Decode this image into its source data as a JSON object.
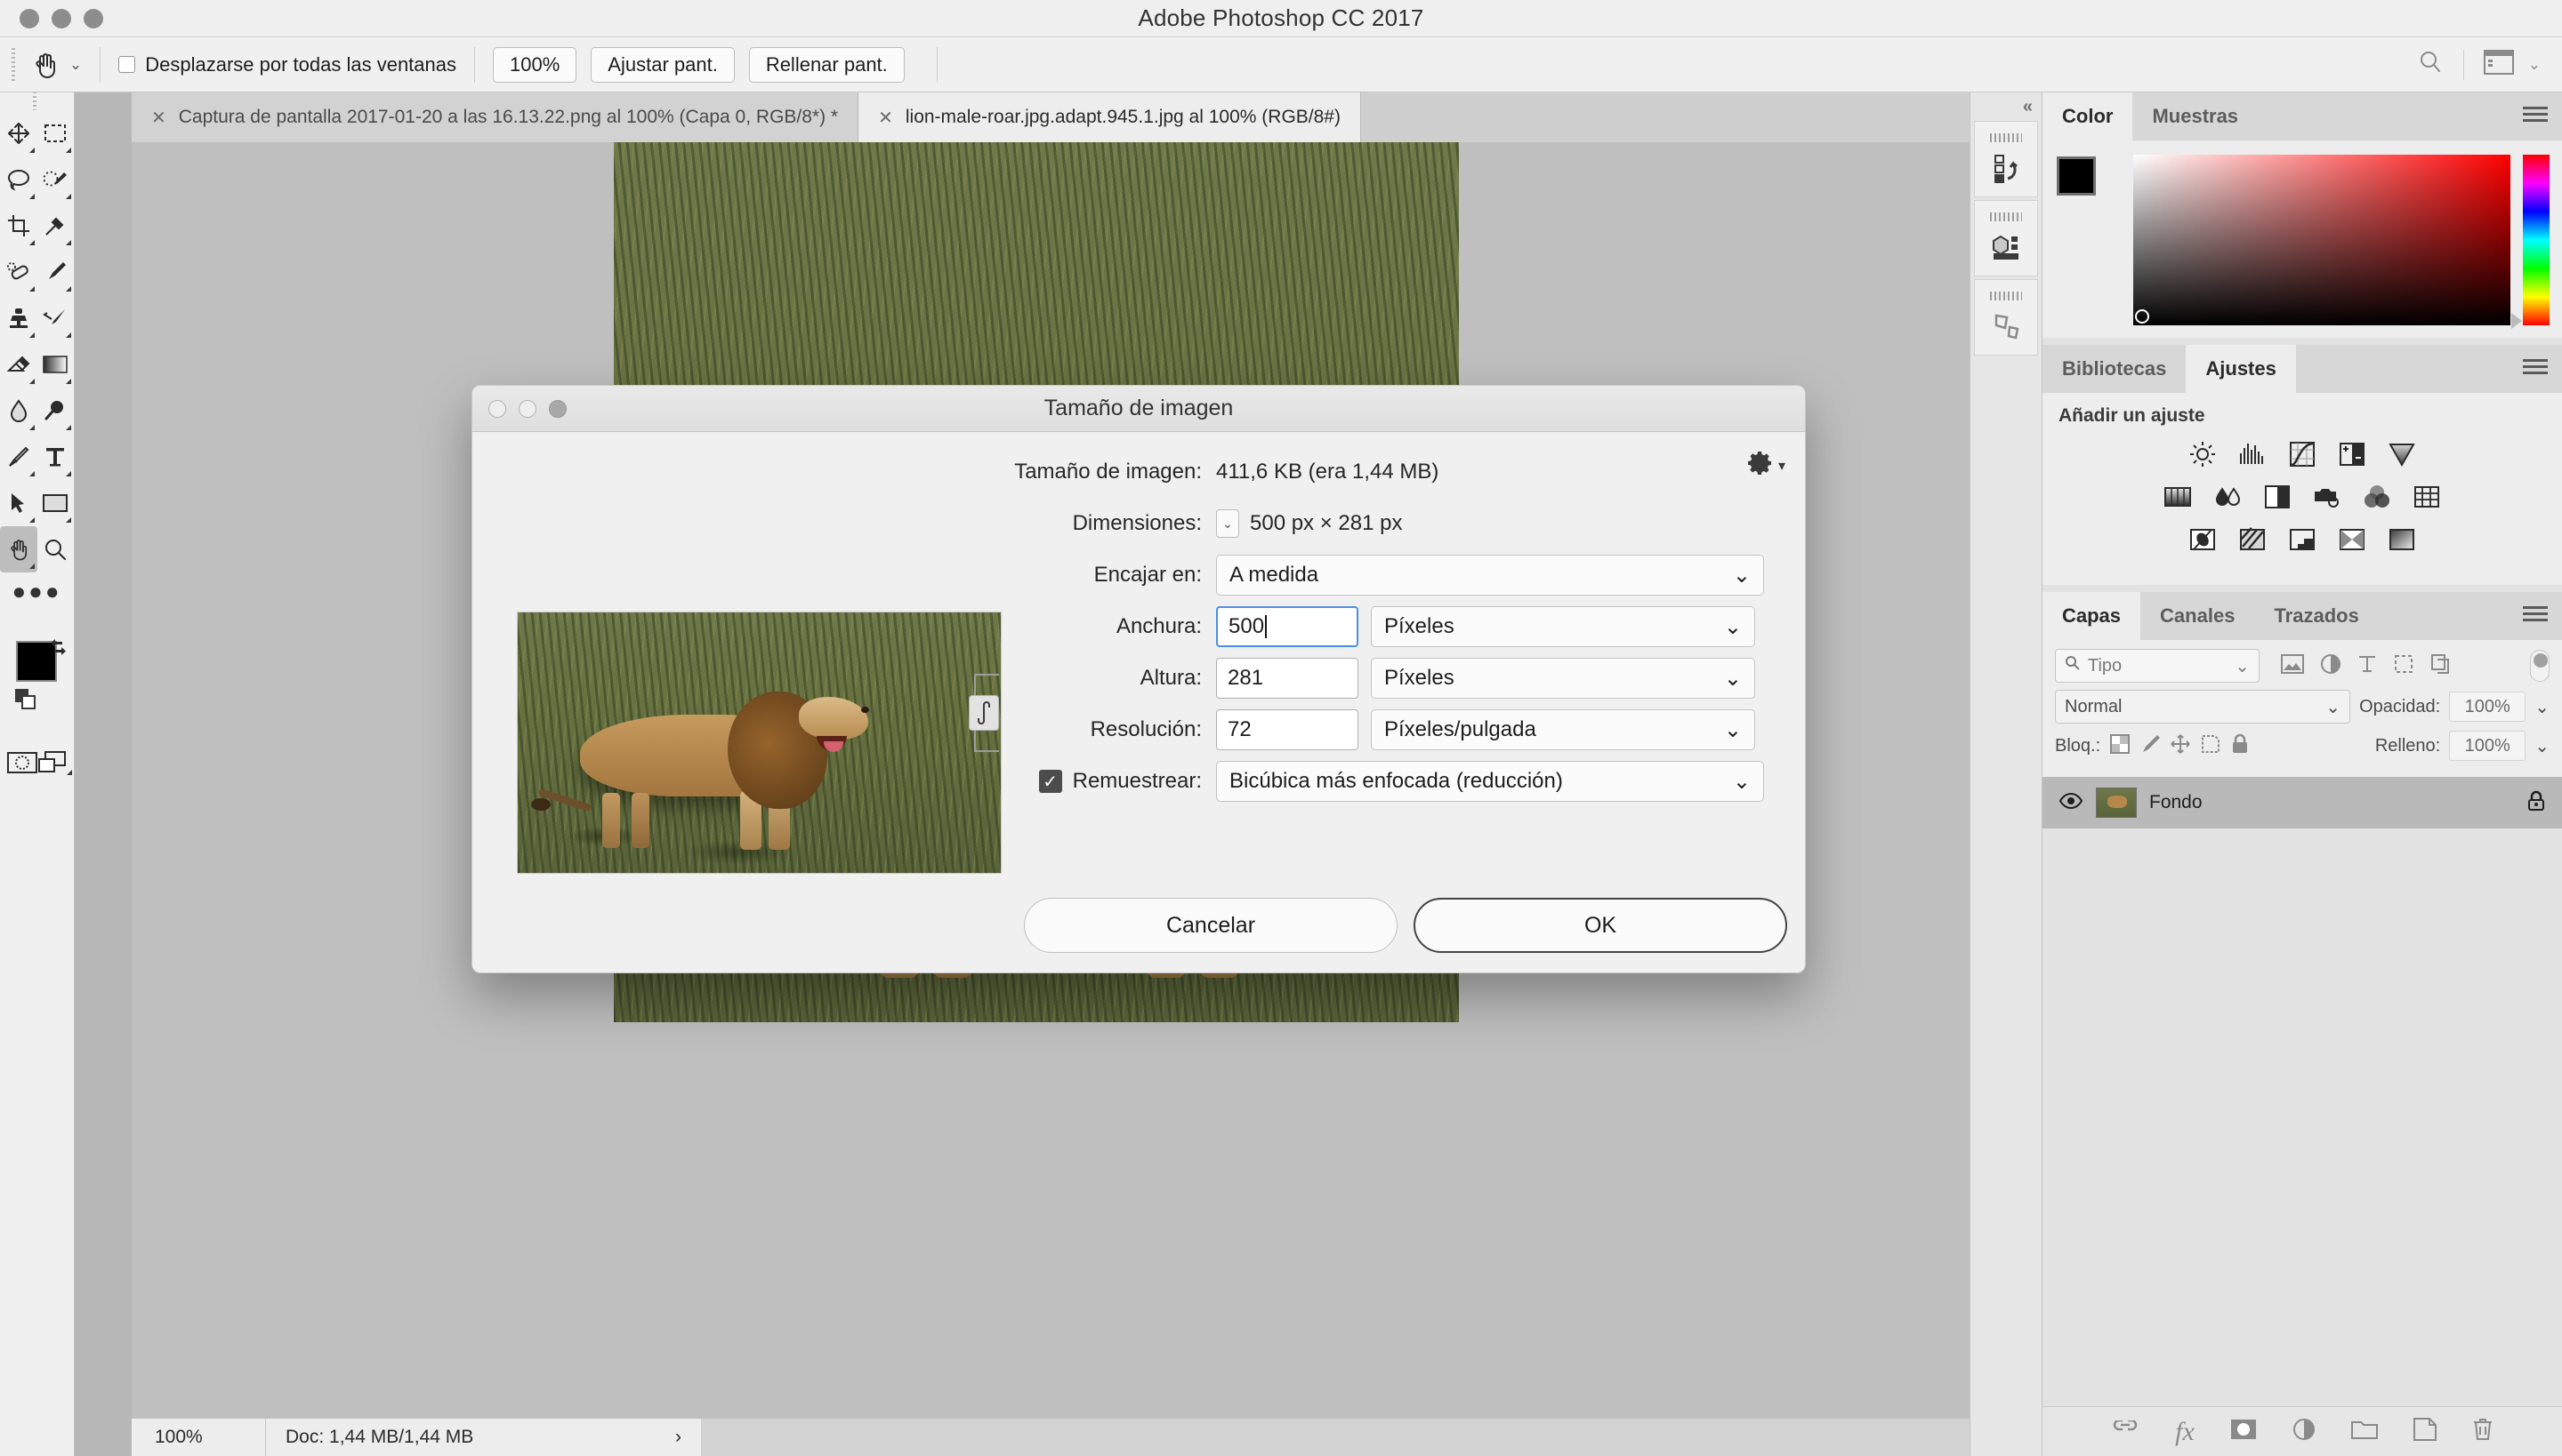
{
  "window": {
    "title": "Adobe Photoshop CC 2017"
  },
  "options_bar": {
    "tool_icon": "hand-tool-icon",
    "scroll_all_windows_label": "Desplazarse por todas las ventanas",
    "scroll_all_windows_checked": false,
    "buttons": [
      "100%",
      "Ajustar pant.",
      "Rellenar pant."
    ],
    "search_icon": "search-icon",
    "workspace_icon": "workspace-switcher-icon"
  },
  "tabs": [
    {
      "label": "Captura de pantalla 2017-01-20 a las 16.13.22.png al 100% (Capa 0, RGB/8*) *",
      "active": false,
      "close": "✕"
    },
    {
      "label": "lion-male-roar.jpg.adapt.945.1.jpg al 100% (RGB/8#)",
      "active": true,
      "close": "✕"
    }
  ],
  "toolbar": {
    "tools": [
      [
        "move-tool-icon",
        "rectangular-marquee-tool-icon"
      ],
      [
        "lasso-tool-icon",
        "quick-selection-tool-icon"
      ],
      [
        "crop-tool-icon",
        "eyedropper-tool-icon"
      ],
      [
        "spot-healing-brush-tool-icon",
        "brush-tool-icon"
      ],
      [
        "clone-stamp-tool-icon",
        "history-brush-tool-icon"
      ],
      [
        "eraser-tool-icon",
        "gradient-tool-icon"
      ],
      [
        "blur-tool-icon",
        "dodge-tool-icon"
      ],
      [
        "pen-tool-icon",
        "type-tool-icon"
      ],
      [
        "path-selection-tool-icon",
        "rectangle-tool-icon"
      ],
      [
        "hand-tool-icon",
        "zoom-tool-icon"
      ]
    ],
    "selected_tool": "hand-tool-icon",
    "more_tools_icon": "more-tools-icon",
    "foreground_color": "#000000",
    "background_color": "#ffffff",
    "swap_colors_icon": "swap-colors-icon",
    "default_colors_icon": "default-colors-icon",
    "quick_mask_icon": "quick-mask-mode-icon",
    "screen_mode_icon": "screen-mode-icon"
  },
  "status_bar": {
    "zoom": "100%",
    "doc_info": "Doc: 1,44 MB/1,44 MB",
    "expand_icon": "›"
  },
  "rail": {
    "collapse_icon": "«",
    "buttons": [
      "history-panel-icon",
      "3d-panel-icon",
      "properties-panel-icon"
    ]
  },
  "panels": {
    "color": {
      "tabs": [
        {
          "label": "Color",
          "active": true
        },
        {
          "label": "Muestras",
          "active": false
        }
      ],
      "menu_icon": "panel-menu-icon",
      "foreground_color": "#000000",
      "background_color": "#ffffff"
    },
    "adjustments": {
      "tabs": [
        {
          "label": "Bibliotecas",
          "active": false
        },
        {
          "label": "Ajustes",
          "active": true
        }
      ],
      "menu_icon": "panel-menu-icon",
      "heading": "Añadir un ajuste",
      "icons": [
        [
          "brightness-contrast-icon",
          "levels-icon",
          "curves-icon",
          "exposure-icon",
          "vibrance-icon"
        ],
        [
          "hue-saturation-icon",
          "color-balance-icon",
          "black-white-icon",
          "photo-filter-icon",
          "channel-mixer-icon",
          "color-lookup-icon"
        ],
        [
          "invert-icon",
          "posterize-icon",
          "threshold-icon",
          "gradient-map-icon",
          "selective-color-icon"
        ]
      ]
    },
    "layers": {
      "tabs": [
        {
          "label": "Capas",
          "active": true
        },
        {
          "label": "Canales",
          "active": false
        },
        {
          "label": "Trazados",
          "active": false
        }
      ],
      "menu_icon": "panel-menu-icon",
      "filter_placeholder": "Tipo",
      "filter_icons": [
        "filter-pixel-icon",
        "filter-adjustment-icon",
        "filter-type-icon",
        "filter-shape-icon",
        "filter-smart-icon"
      ],
      "blend_mode": "Normal",
      "opacity_label": "Opacidad:",
      "opacity_value": "100%",
      "lock_label": "Bloq.:",
      "lock_icons": [
        "lock-transparency-icon",
        "lock-image-icon",
        "lock-position-icon",
        "lock-artboard-icon",
        "lock-all-icon"
      ],
      "fill_label": "Relleno:",
      "fill_value": "100%",
      "items": [
        {
          "name": "Fondo",
          "visible": true,
          "locked": true,
          "visibility_icon": "eye-icon",
          "lock_icon": "lock-icon"
        }
      ],
      "footer_icons": [
        "link-layers-icon",
        "layer-style-icon",
        "layer-mask-icon",
        "adjustment-layer-icon",
        "new-group-icon",
        "new-layer-icon",
        "delete-layer-icon"
      ]
    }
  },
  "dialog": {
    "title": "Tamaño de imagen",
    "traffic_lights": [
      "close",
      "minimize",
      "zoom"
    ],
    "image_size_label": "Tamaño de imagen:",
    "image_size_value": "411,6 KB (era 1,44 MB)",
    "gear_icon": "gear-icon",
    "dimensions_label": "Dimensiones:",
    "dimensions_value": "500 px × 281 px",
    "fit_to_label": "Encajar en:",
    "fit_to_value": "A medida",
    "width_label": "Anchura:",
    "width_value": "500",
    "width_unit": "Píxeles",
    "height_label": "Altura:",
    "height_value": "281",
    "height_unit": "Píxeles",
    "resolution_label": "Resolución:",
    "resolution_value": "72",
    "resolution_unit": "Píxeles/pulgada",
    "resample_label": "Remuestrear:",
    "resample_checked": true,
    "resample_value": "Bicúbica más enfocada (reducción)",
    "chain_icon": "link-constrain-icon",
    "cancel_label": "Cancelar",
    "ok_label": "OK",
    "preview_alt": "lion-preview-image"
  }
}
